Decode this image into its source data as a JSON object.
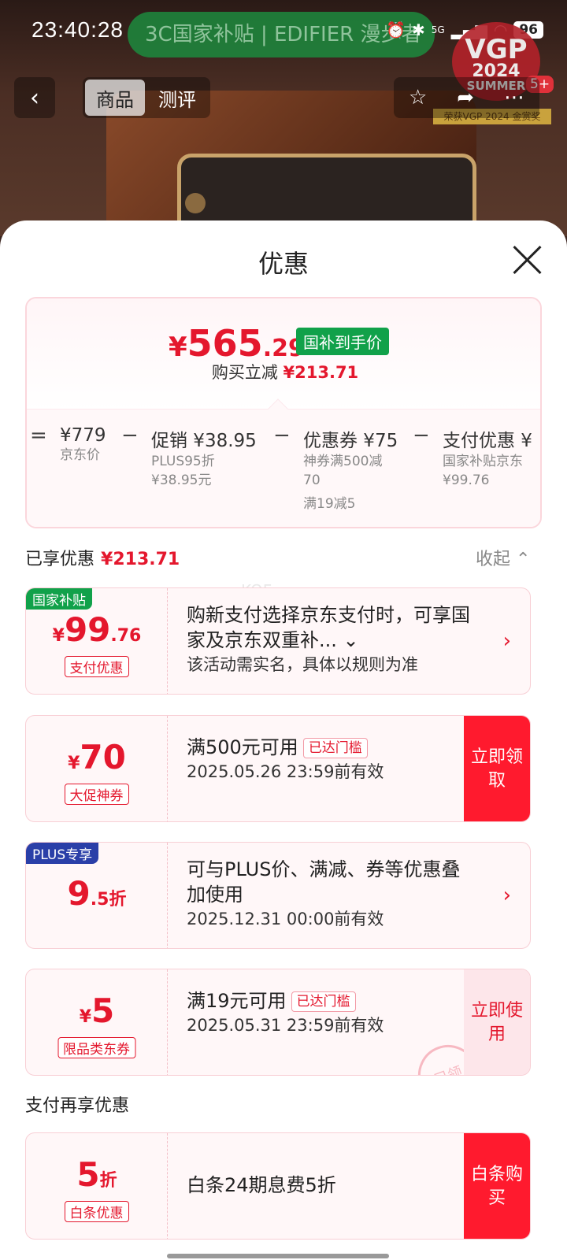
{
  "status_bar": {
    "time": "23:40:28",
    "banner": "3C国家补贴 | EDIFIER 漫步者",
    "network": "5G",
    "battery": "96"
  },
  "product_image": {
    "vgp_top": "VGP",
    "vgp_year": "2024",
    "vgp_season": "SUMMER",
    "badge_count": "5+",
    "award": "荣获VGP 2024 金赏奖"
  },
  "top_nav": {
    "tabs": [
      {
        "label": "商品"
      },
      {
        "label": "测评"
      }
    ]
  },
  "sheet": {
    "title": "优惠",
    "summary": {
      "currency": "¥",
      "price_int": "565",
      "price_dec": ".29",
      "tag": "国补到手价",
      "cut_label": "购买立减",
      "cut_value": "¥213.71",
      "breakdown": [
        {
          "op": "=",
          "head": "¥779",
          "subs": [
            "京东价"
          ]
        },
        {
          "op": "−",
          "head": "促销 ¥38.95",
          "subs": [
            "PLUS95折",
            "¥38.95元"
          ]
        },
        {
          "op": "−",
          "head": "优惠券 ¥75",
          "subs": [
            "神券满500减",
            "70",
            "满19减5"
          ]
        },
        {
          "op": "−",
          "head": "支付优惠 ¥",
          "subs": [
            "国家补贴京东",
            "¥99.76"
          ]
        }
      ]
    },
    "enjoyed": {
      "label": "已享优惠",
      "value": "¥213.71",
      "collapse": "收起 ⌃"
    },
    "watermark": "KOF",
    "cards": [
      {
        "corner": "国家补贴",
        "corner_color": "#11a14a",
        "currency": "¥",
        "amount": "99",
        "decimal": ".76",
        "tag": "支付优惠",
        "line1": "购新支付选择京东支付时，可享国家及京东双重补... ⌄",
        "line2": "该活动需实名，具体以规则为准",
        "arrow": "›"
      },
      {
        "currency": "¥",
        "amount": "70",
        "decimal": "",
        "tag": "大促神券",
        "line1": "满500元可用",
        "threshold": "已达门槛",
        "line2": "2025.05.26 23:59前有效",
        "action": "立即领取"
      },
      {
        "corner": "PLUS专享",
        "corner_color": "#2a3fa8",
        "currency": "",
        "amount": "9",
        "decimal": ".5折",
        "line1": "可与PLUS价、满减、券等优惠叠加使用",
        "line2": "2025.12.31 00:00前有效",
        "arrow": "›"
      },
      {
        "currency": "¥",
        "amount": "5",
        "decimal": "",
        "tag": "限品类东券",
        "line1": "满19元可用",
        "threshold": "已达门槛",
        "line2": "2025.05.31 23:59前有效",
        "action": "立即使用",
        "stamp": "已领"
      }
    ],
    "pay_section": "支付再享优惠",
    "pay_card": {
      "amount": "5",
      "decimal": "折",
      "tag": "白条优惠",
      "line1": "白条24期息费5折",
      "action": "白条购买"
    }
  }
}
